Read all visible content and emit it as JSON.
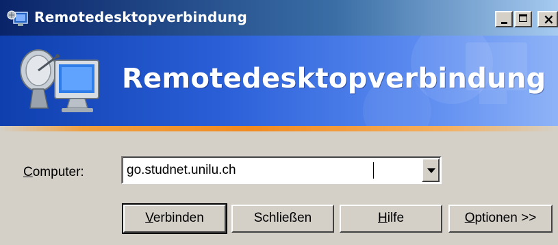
{
  "window": {
    "title": "Remotedesktopverbindung",
    "icon": "remote-desktop-icon"
  },
  "banner": {
    "title": "Remotedesktopverbindung",
    "icon": "remote-desktop-logo"
  },
  "form": {
    "computer_label_accel": "C",
    "computer_label_rest": "omputer:",
    "computer_value": "go.studnet.unilu.ch"
  },
  "buttons": {
    "connect_accel": "V",
    "connect_rest": "erbinden",
    "close_label": "Schließen",
    "help_accel": "H",
    "help_rest": "ilfe",
    "options_accel": "O",
    "options_rest": "ptionen >>"
  },
  "colors": {
    "titlebar_start": "#0a246a",
    "banner_blue": "#2a5fd8",
    "accent_orange": "#f28a1f",
    "dialog_bg": "#d4d0c8"
  }
}
